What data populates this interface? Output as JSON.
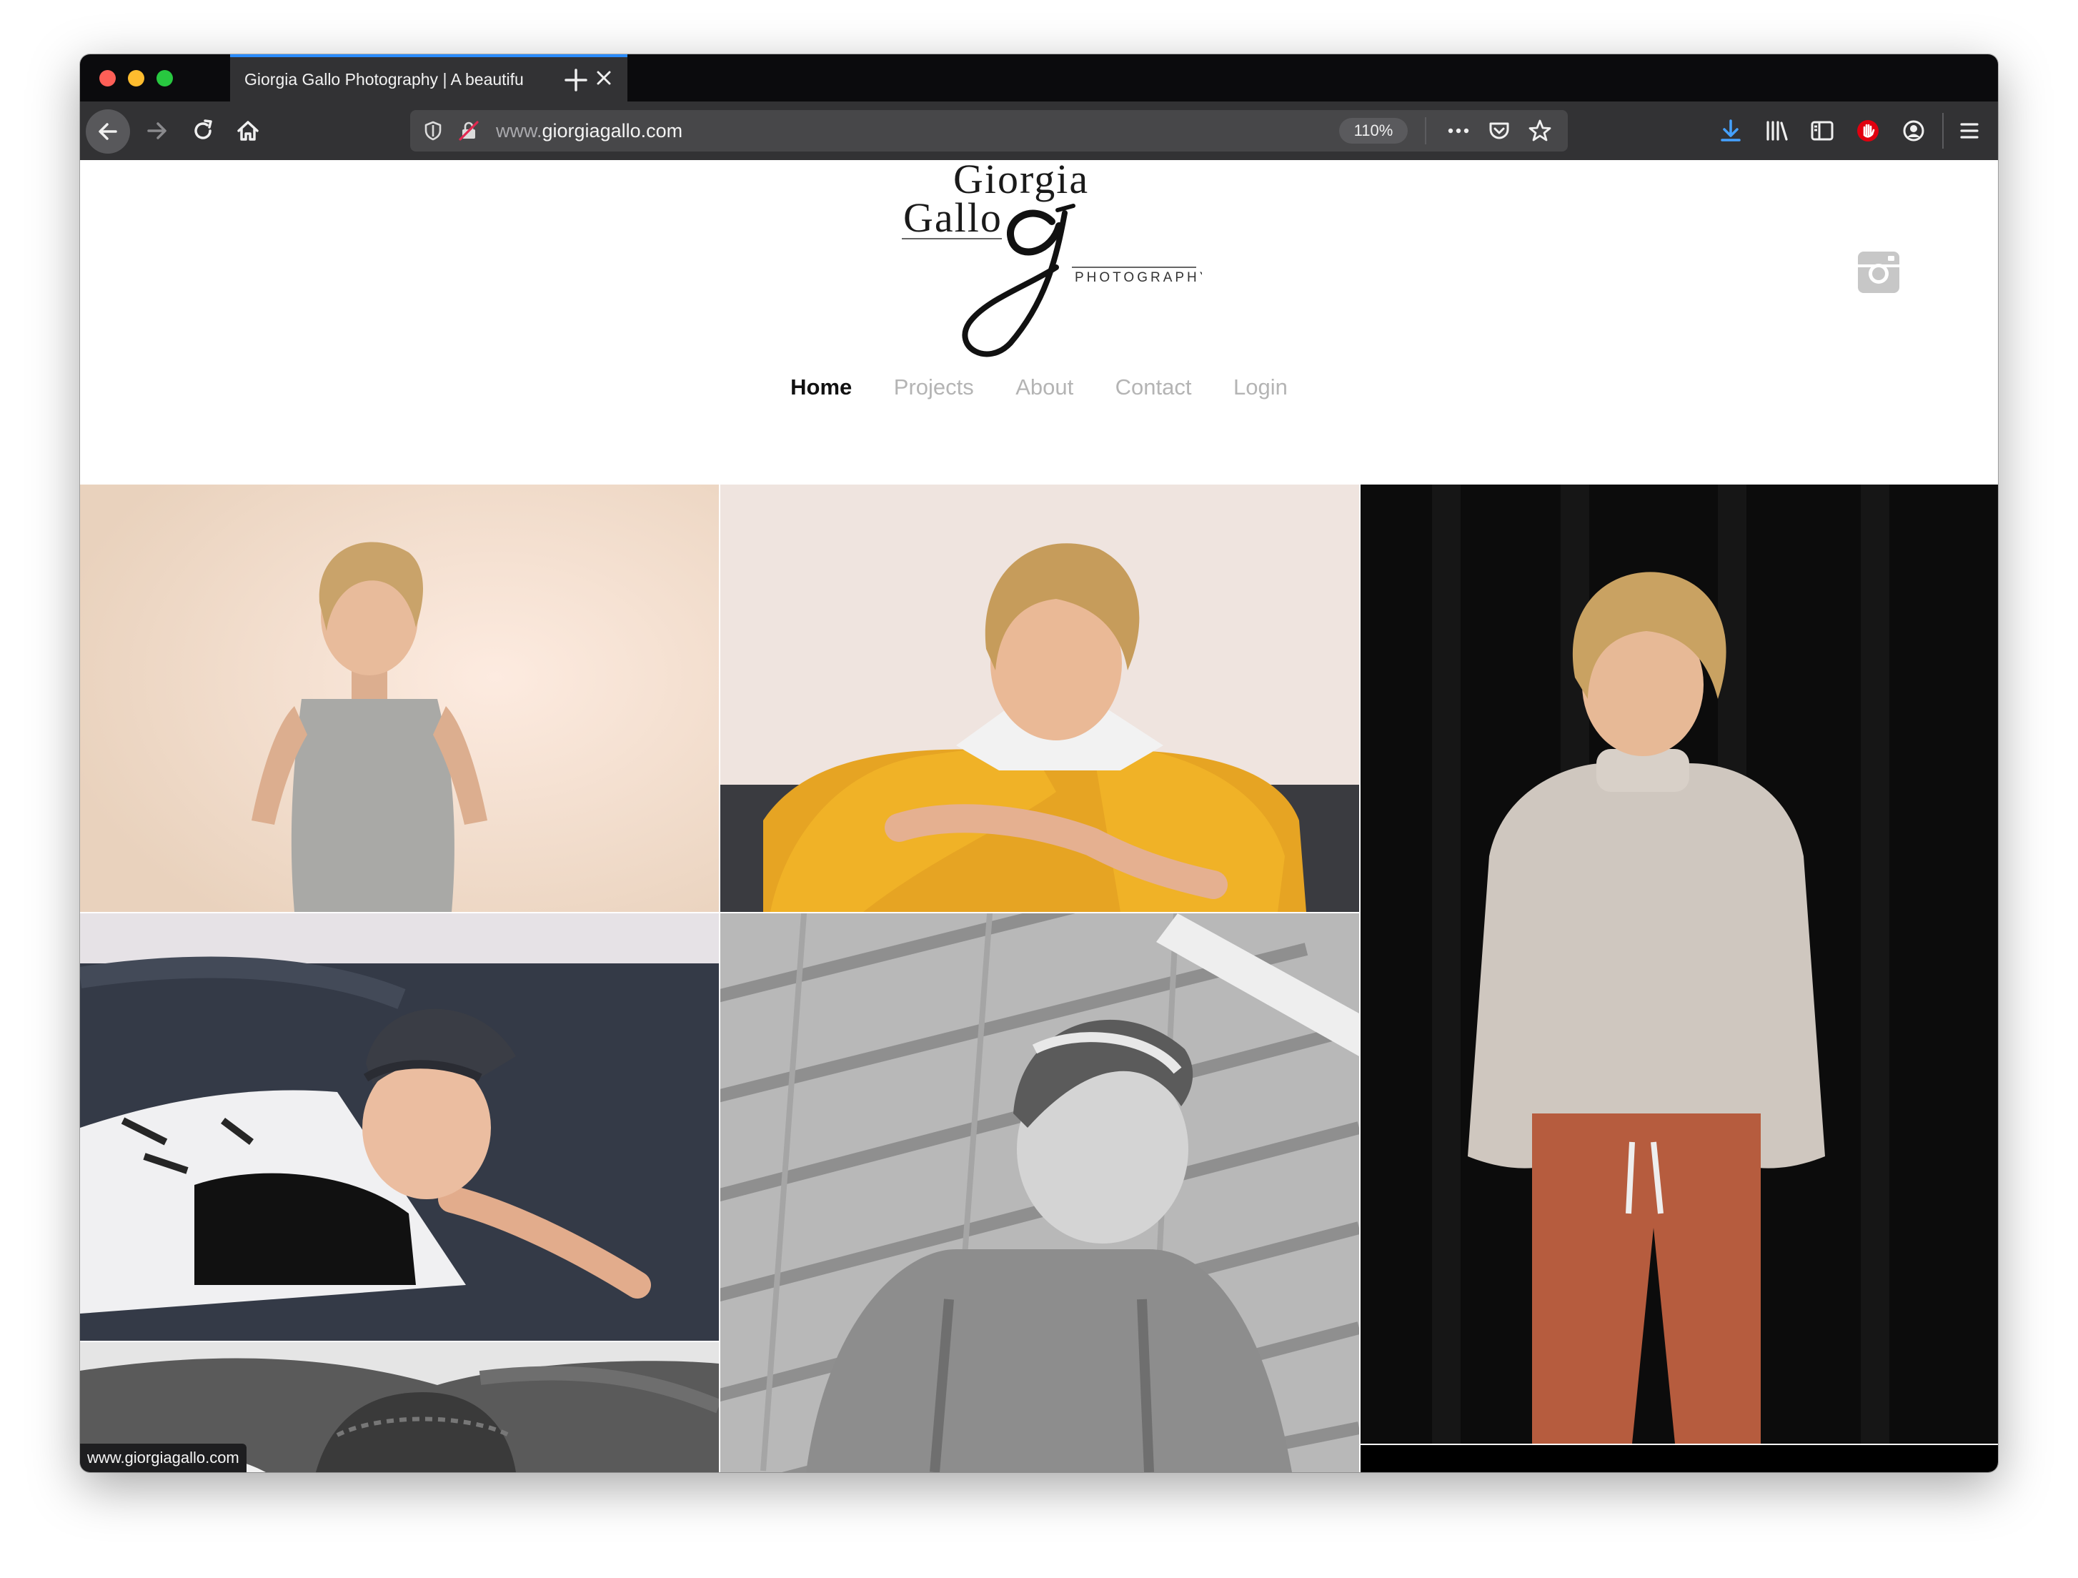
{
  "browser": {
    "tab_title": "Giorgia Gallo Photography | A beautiful",
    "url_prefix": "www.",
    "url_domain": "giorgiagallo.com",
    "zoom": "110%",
    "status_url": "www.giorgiagallo.com",
    "accent_color": "#2a8cff"
  },
  "site": {
    "logo": {
      "line1": "Giorgia",
      "line2": "Gallo",
      "mark": "g",
      "tagline": "PHOTOGRAPHY"
    },
    "nav": [
      {
        "label": "Home",
        "active": true
      },
      {
        "label": "Projects",
        "active": false
      },
      {
        "label": "About",
        "active": false
      },
      {
        "label": "Contact",
        "active": false
      },
      {
        "label": "Login",
        "active": false
      }
    ],
    "social_icon": "instagram-icon"
  },
  "gallery": [
    {
      "name": "photo-boy-grey-tank",
      "style": "color",
      "background": "#f3dccb"
    },
    {
      "name": "photo-boy-yellow-hoodie",
      "style": "color",
      "background": "#efe2dc"
    },
    {
      "name": "photo-boy-turtleneck",
      "style": "color",
      "background": "#0c0c0c"
    },
    {
      "name": "photo-boy-cap-sofa",
      "style": "color",
      "background": "#3a3f4b"
    },
    {
      "name": "photo-boy-floor-bw",
      "style": "monochrome",
      "background": "#bcbcbc"
    },
    {
      "name": "photo-boy-cap-bw",
      "style": "monochrome",
      "background": "#5a5a5a"
    },
    {
      "name": "photo-dark-tile",
      "style": "color",
      "background": "#000000"
    }
  ]
}
